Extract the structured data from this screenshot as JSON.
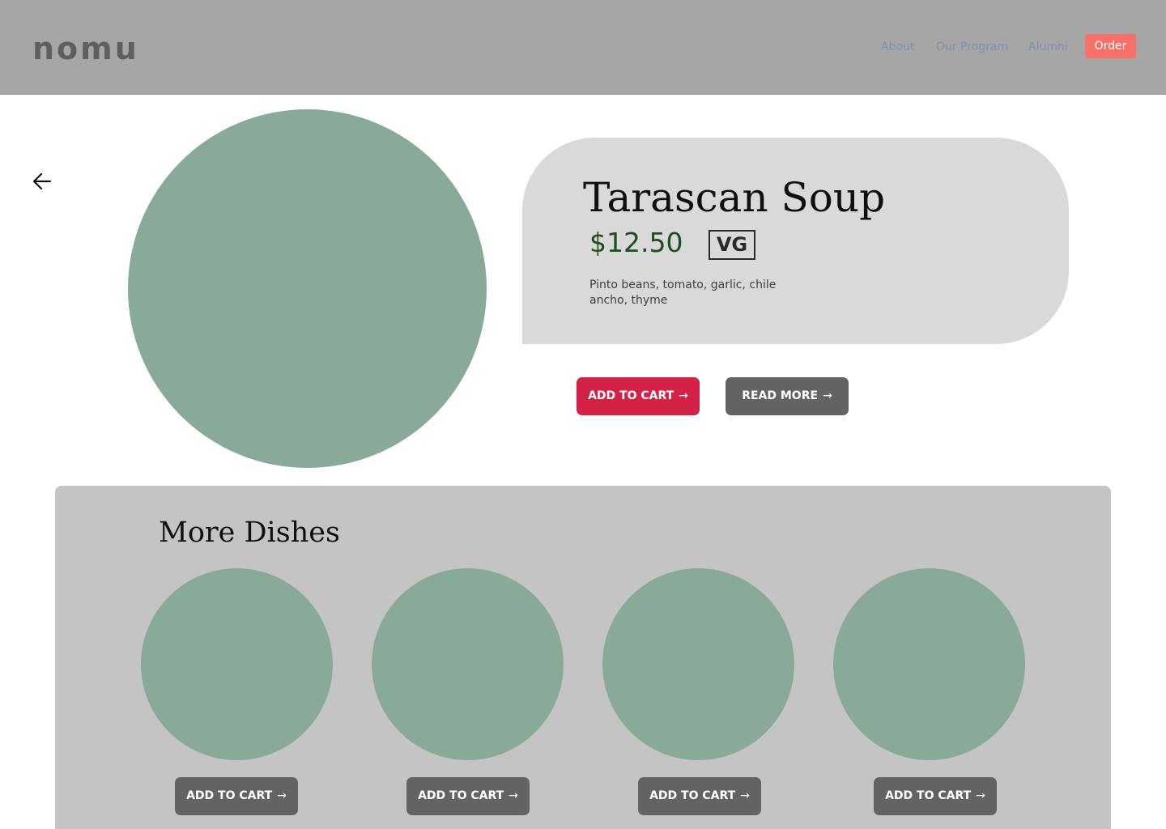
{
  "header": {
    "logo": "nomu",
    "nav": [
      "About",
      "Our Program",
      "Alumni"
    ],
    "order_label": "Order"
  },
  "icons": {
    "back": "arrow-left-icon",
    "button_arrow": "arrow-right-icon"
  },
  "dish": {
    "title": "Tarascan Soup",
    "price": "$12.50",
    "badge": "VG",
    "description": "Pinto beans, tomato, garlic, chile ancho, thyme",
    "add_to_cart": "ADD TO CART",
    "read_more": "READ MORE"
  },
  "more": {
    "title": "More Dishes",
    "items": [
      {
        "button": "ADD TO CART"
      },
      {
        "button": "ADD TO CART"
      },
      {
        "button": "ADD TO CART"
      },
      {
        "button": "ADD TO CART"
      }
    ]
  },
  "colors": {
    "header_bg": "#a6a6a6",
    "nav_link": "#7f8fb0",
    "order_button": "#f87166",
    "image_placeholder": "#8aaa99",
    "card_bg": "#d9d9d9",
    "price": "#1e4d1e",
    "add_to_cart": "#d42247",
    "secondary_button": "#636363",
    "panel_bg": "#c4c4c4"
  }
}
